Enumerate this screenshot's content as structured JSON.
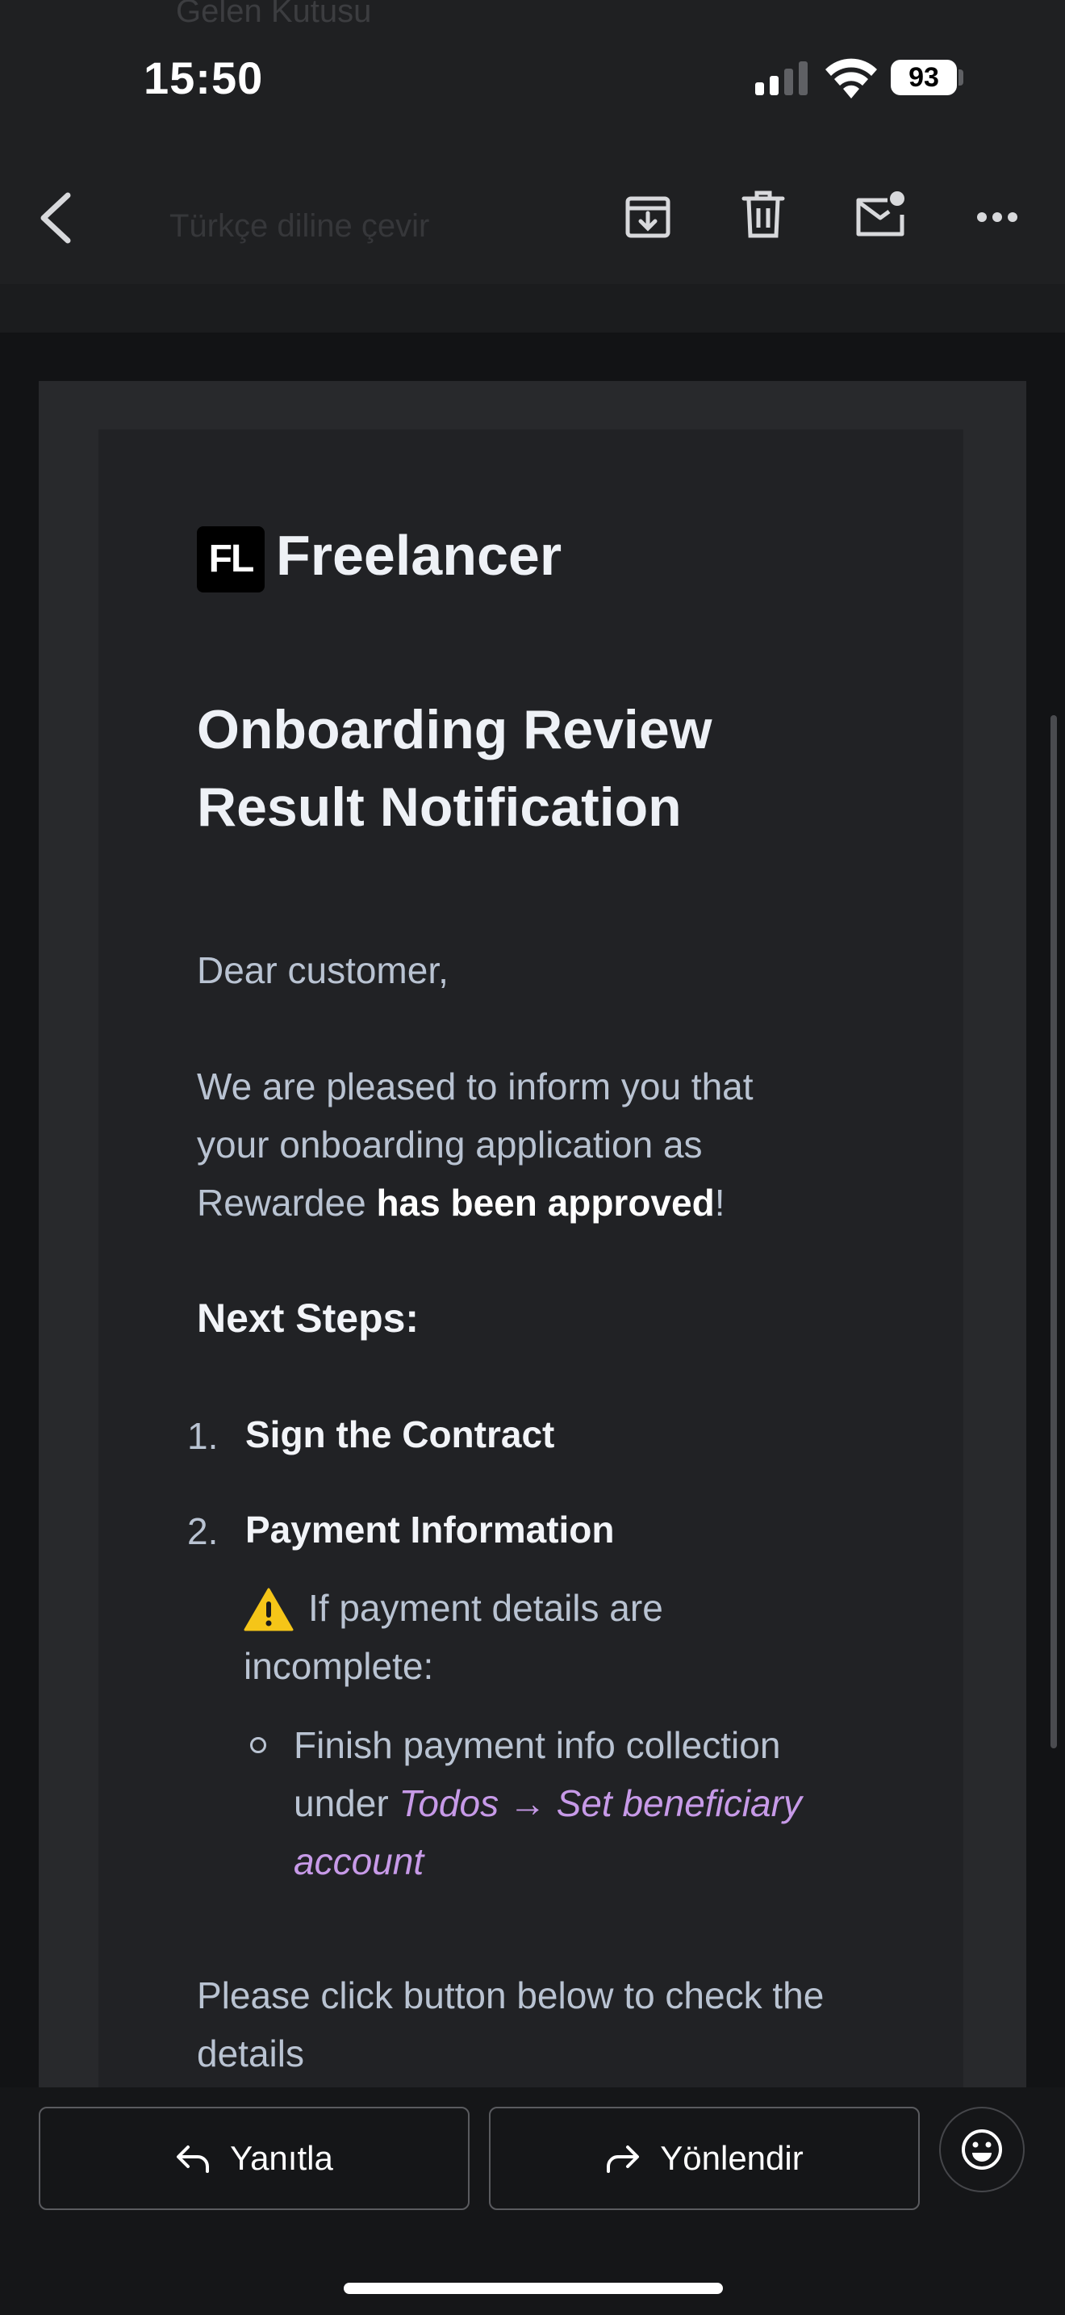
{
  "status": {
    "time": "15:50",
    "battery": "93"
  },
  "toolbar": {
    "ghost_subject": "Gelen Kutusu",
    "translate_label": "Türkçe diline çevir",
    "icons": [
      "back-icon",
      "archive-icon",
      "trash-icon",
      "mail-unread-icon",
      "more-icon"
    ]
  },
  "email": {
    "logo_mark": "FL",
    "logo_name": "Freelancer",
    "title_line1": "Onboarding Review",
    "title_line2": "Result Notification",
    "greeting": "Dear customer,",
    "body_line1": "We are pleased to inform you that",
    "body_line2": "your onboarding application as",
    "body_line3_start": "Rewardee ",
    "body_line3_bold": "has been approved",
    "body_line3_end": "!",
    "next_steps": "Next Steps:",
    "steps": [
      {
        "num": "1.",
        "label": "Sign the Contract"
      },
      {
        "num": "2.",
        "label": "Payment Information"
      }
    ],
    "warning_line1": "If payment details are",
    "warning_line2": "incomplete:",
    "sub_line1": "Finish payment info collection",
    "sub_line2_start": "under ",
    "sub_link_1": "Todos → Set beneficiary",
    "sub_link_2": "account",
    "cta_line1": "Please click button below to check the",
    "cta_line2": "details"
  },
  "actions": {
    "reply": "Yanıtla",
    "forward": "Yönlendir"
  }
}
